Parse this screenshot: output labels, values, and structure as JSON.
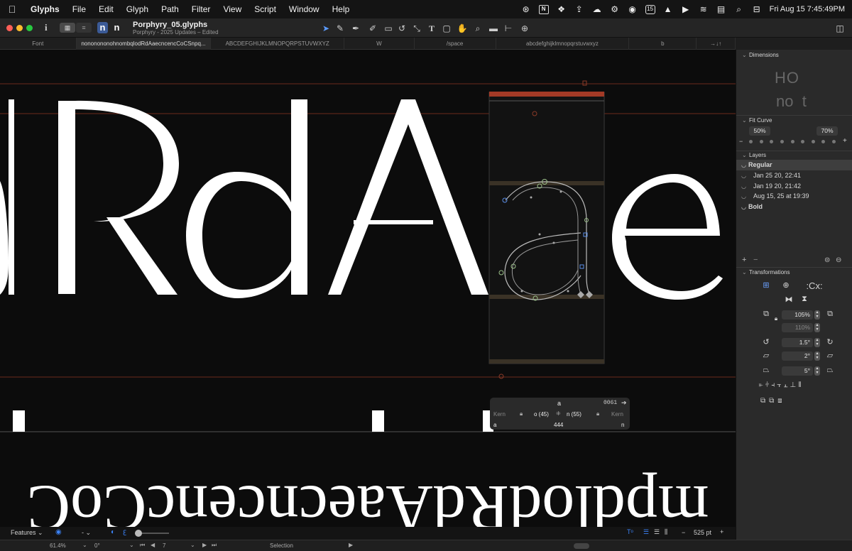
{
  "menubar": {
    "apple": "",
    "items": [
      "Glyphs",
      "File",
      "Edit",
      "Glyph",
      "Path",
      "Filter",
      "View",
      "Script",
      "Window",
      "Help"
    ],
    "datetime": "Fri Aug 15  7:45:49PM",
    "calendar_day": "15"
  },
  "window": {
    "title": "Porphyry_05.glyphs",
    "subtitle": "Porphyry - 2025 Updates – Edited",
    "glyph_preview_1": "n",
    "glyph_preview_2": "n",
    "info_glyph": "i"
  },
  "tabs": [
    "Font",
    "nononononohnombqlodRdAaecncencCoCSnpq...",
    "ABCDEFGHIJKLMNOPQRPSTUVWXYZ",
    "W",
    "/space",
    "abcdefghijklmnopqrstuvwxyz",
    "b",
    "→↓↑"
  ],
  "canvas": {
    "main_text": "dRdAae",
    "preview_text": "mpdlodRdAaecncencCoC",
    "edited_glyph": "a"
  },
  "infobox": {
    "glyph_name": "a",
    "unicode": "0061",
    "kern_left_label": "Kern",
    "kern_right_label": "Kern",
    "left_group": "o (45)",
    "right_group": "n (55)",
    "left_sb": "a",
    "width": "444",
    "right_sb": "n"
  },
  "sidebar": {
    "dimensions": {
      "label": "Dimensions",
      "preview_top": "HO",
      "preview_bottom": "no  t"
    },
    "fit_curve": {
      "label": "Fit Curve",
      "left": "50%",
      "right": "70%",
      "minus": "−",
      "plus": "+"
    },
    "layers": {
      "label": "Layers",
      "items": [
        {
          "name": "Regular",
          "kind": "master"
        },
        {
          "name": "Jan 25 20, 22:41",
          "kind": "layer"
        },
        {
          "name": "Jan 19 20, 21:42",
          "kind": "layer"
        },
        {
          "name": "Aug 15, 25 at 19:39",
          "kind": "layer"
        },
        {
          "name": "Bold",
          "kind": "master"
        }
      ],
      "add": "+",
      "remove": "−"
    },
    "transformations": {
      "label": "Transformations",
      "scale": "105%",
      "scale_y": "110%",
      "rotate": "1.5°",
      "slant": "2°",
      "skew": "5°"
    }
  },
  "bottombar": {
    "features_label": "Features",
    "dash": "-",
    "font_size": "525 pt",
    "minus": "−",
    "plus": "+"
  },
  "statusbar": {
    "zoom": "61.4%",
    "angle": "0°",
    "page": "7",
    "mode": "Selection"
  },
  "colors": {
    "accent": "#3b82f6",
    "metric_line": "#8a3a28",
    "canvas_bg": "#0c0c0c",
    "glyph_fill": "#ffffff"
  }
}
